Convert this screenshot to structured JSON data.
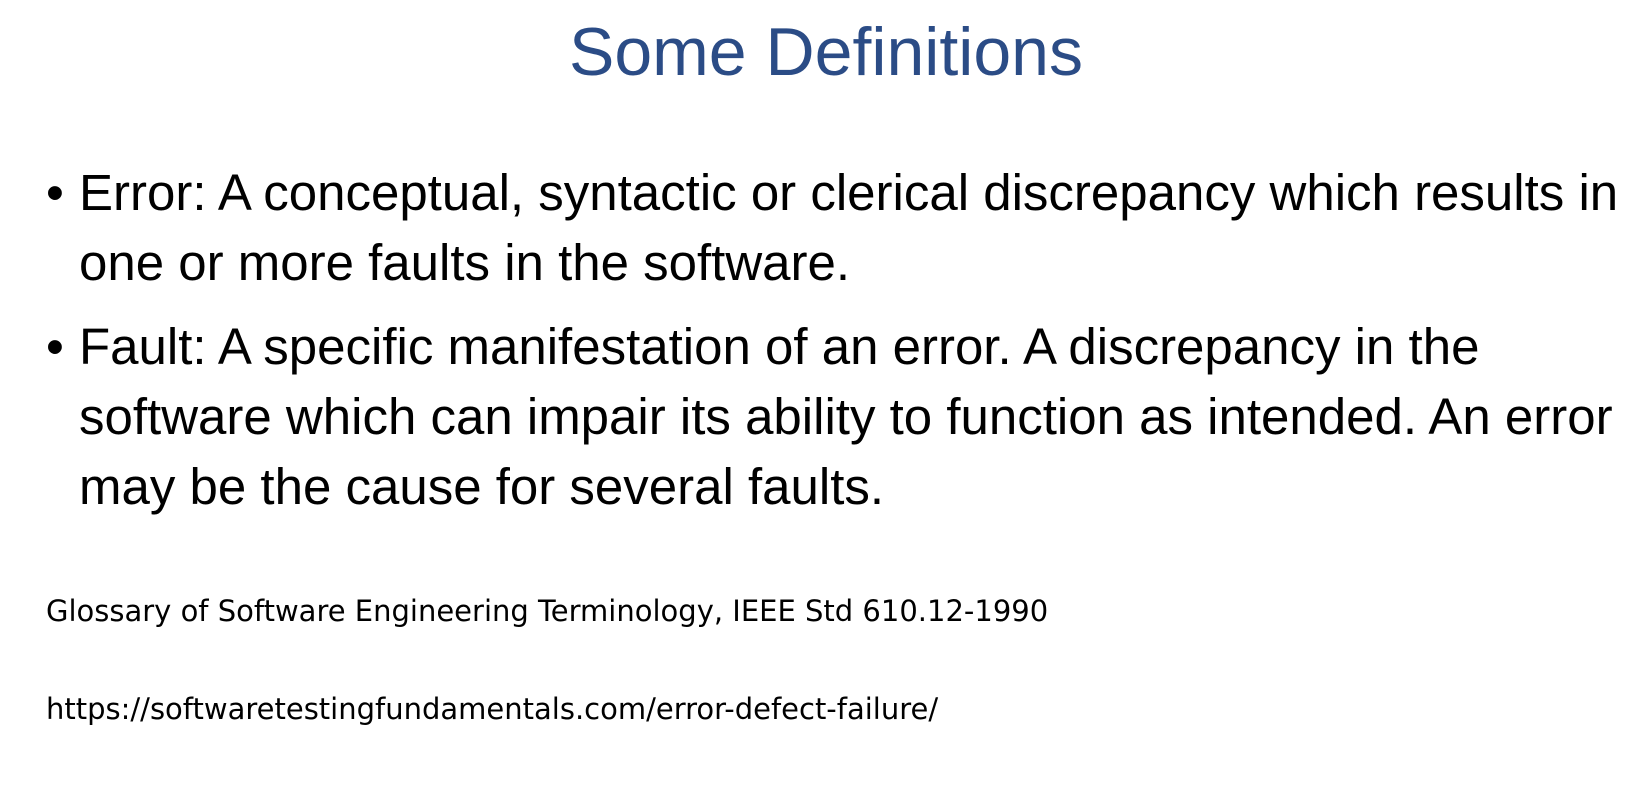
{
  "slide": {
    "title": "Some Definitions",
    "bullets": [
      {
        "marker": "•",
        "text": "Error: A conceptual, syntactic or clerical discrepancy which results in one or more faults in the software."
      },
      {
        "marker": "•",
        "text": "Fault: A specific manifestation of an error. A discrepancy in the software which can impair its ability to function as intended. An error may be the cause for several faults."
      }
    ],
    "references": [
      "Glossary of Software Engineering Terminology, IEEE Std 610.12-1990",
      "https://softwaretestingfundamentals.com/error-defect-failure/"
    ]
  },
  "colors": {
    "title": "#2b4c86",
    "body_text": "#000000",
    "background": "#ffffff"
  }
}
